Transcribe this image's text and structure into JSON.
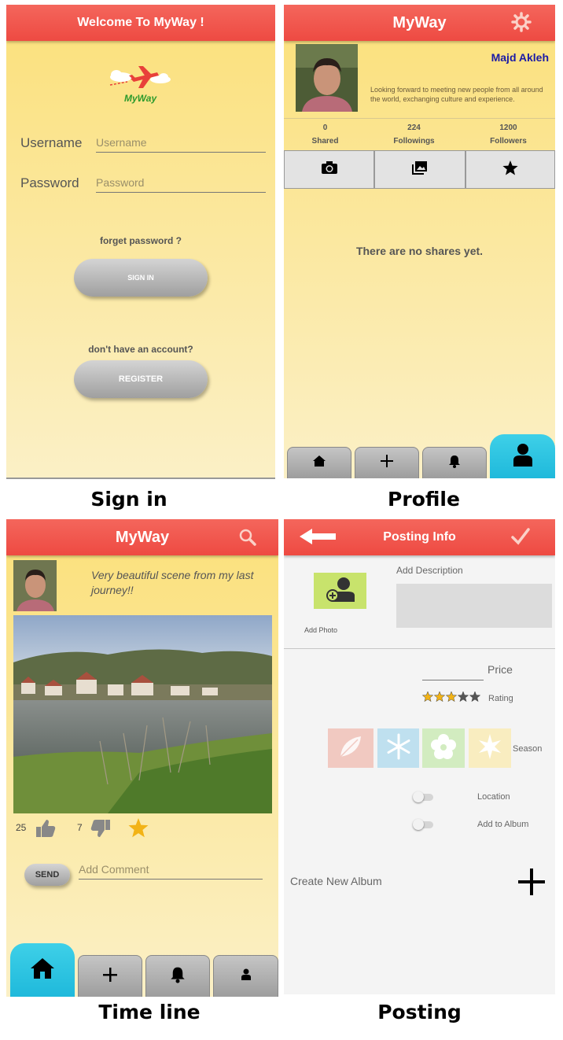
{
  "captions": {
    "signin": "Sign in",
    "profile": "Profile",
    "timeline": "Time line",
    "posting": "Posting"
  },
  "signin": {
    "title": "Welcome To MyWay !",
    "logo_text": "MyWay",
    "username_label": "Username",
    "username_placeholder": "Username",
    "password_label": "Password",
    "password_placeholder": "Password",
    "forget": "forget password ?",
    "signin_button": "SIGN IN",
    "no_account": "don't have an account?",
    "register_button": "REGISTER"
  },
  "profile": {
    "title": "MyWay",
    "name": "Majd Akleh",
    "bio": "Looking forward to meeting new people from all around the world, exchanging culture and experience.",
    "stats": [
      {
        "value": "0",
        "label": "Shared"
      },
      {
        "value": "224",
        "label": "Followings"
      },
      {
        "value": "1200",
        "label": "Followers"
      }
    ],
    "empty_message": "There are no shares yet."
  },
  "timeline": {
    "title": "MyWay",
    "post_text": "Very beautiful scene from my last journey!!",
    "likes": "25",
    "dislikes": "7",
    "send_button": "SEND",
    "comment_placeholder": "Add Comment"
  },
  "posting": {
    "title": "Posting Info",
    "add_description": "Add Description",
    "add_photo": "Add Photo",
    "price_label": "Price",
    "rating_label": "Rating",
    "rating_value": 3,
    "rating_max": 5,
    "season_label": "Season",
    "location_label": "Location",
    "album_label": "Add to Album",
    "create_album": "Create New Album"
  },
  "colors": {
    "header_red": "#ee4a42",
    "tab_cyan": "#1fb9db",
    "name_blue": "#1a1aa6",
    "star_gold": "#f2b316"
  }
}
